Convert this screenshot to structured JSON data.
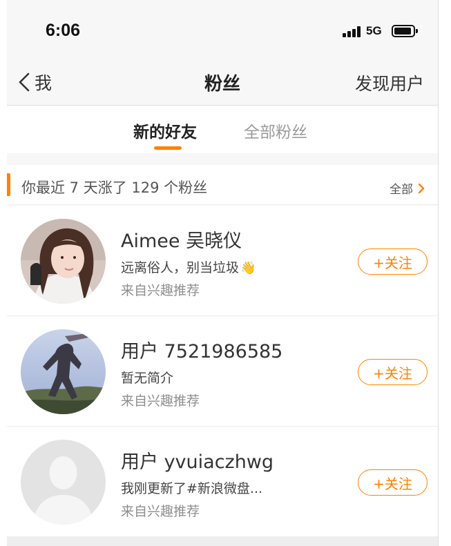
{
  "status_bar": {
    "time": "6:06",
    "network": "5G",
    "icons": [
      "signal-bars-icon",
      "battery-icon"
    ]
  },
  "nav": {
    "back_label": "我",
    "title": "粉丝",
    "right_action": "发现用户"
  },
  "tabs": [
    {
      "label": "新的好友",
      "active": true
    },
    {
      "label": "全部粉丝",
      "active": false
    }
  ],
  "recent": {
    "text": "你最近 7 天涨了 129 个粉丝",
    "all_label": "全部"
  },
  "followers": [
    {
      "name": "Aimee 吴晓仪",
      "bio": "远离俗人，别当垃圾",
      "bio_emoji": "👋",
      "source": "来自兴趣推荐",
      "follow_label": "+关注",
      "avatar": "photo-avatar-girl"
    },
    {
      "name": "用户 7521986585",
      "bio": "暂无简介",
      "source": "来自兴趣推荐",
      "follow_label": "+关注",
      "avatar": "photo-avatar-landscape"
    },
    {
      "name": "用户 yvuiaczhwg",
      "bio": "我刚更新了#新浪微盘...",
      "source": "来自兴趣推荐",
      "follow_label": "+关注",
      "avatar": "default-avatar-icon"
    }
  ],
  "colors": {
    "accent": "#ff8200",
    "background": "#f7f7f7",
    "text_primary": "#333333",
    "text_secondary": "#8e8e8e"
  }
}
